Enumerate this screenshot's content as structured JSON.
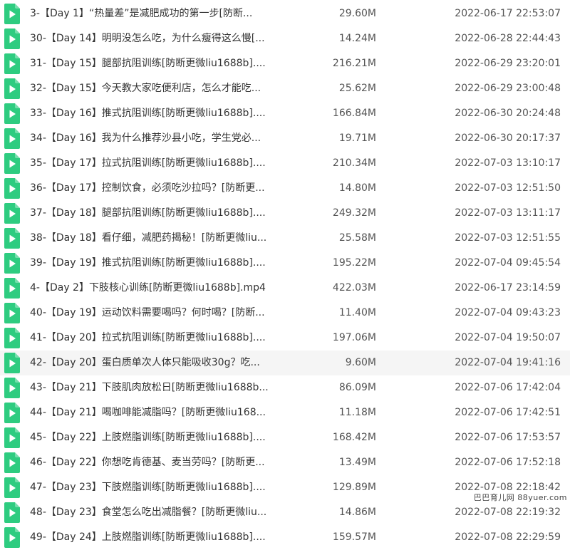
{
  "colors": {
    "icon_green": "#2ecc80",
    "icon_play": "#ffffff",
    "hover_row": "#f5f5f5"
  },
  "icon": "video-file-icon",
  "files": [
    {
      "name": "3-【Day 1】“热量差”是减肥成功的第一步[防断...",
      "size": "29.60M",
      "date": "2022-06-17 22:53:07"
    },
    {
      "name": "30-【Day 14】明明没怎么吃，为什么瘦得这么慢[...",
      "size": "14.24M",
      "date": "2022-06-28 22:44:43"
    },
    {
      "name": "31-【Day 15】腿部抗阻训练[防断更微liu1688b]....",
      "size": "216.21M",
      "date": "2022-06-29 23:20:01"
    },
    {
      "name": "32-【Day 15】今天教大家吃便利店，怎么才能吃...",
      "size": "25.62M",
      "date": "2022-06-29 23:00:48"
    },
    {
      "name": "33-【Day 16】推式抗阻训练[防断更微liu1688b]....",
      "size": "166.84M",
      "date": "2022-06-30 20:24:48"
    },
    {
      "name": "34-【Day 16】我为什么推荐沙县小吃，学生党必...",
      "size": "19.71M",
      "date": "2022-06-30 20:17:37"
    },
    {
      "name": "35-【Day 17】拉式抗阻训练[防断更微liu1688b]....",
      "size": "210.34M",
      "date": "2022-07-03 13:10:17"
    },
    {
      "name": "36-【Day 17】控制饮食，必须吃沙拉吗？[防断更...",
      "size": "14.80M",
      "date": "2022-07-03 12:51:50"
    },
    {
      "name": "37-【Day 18】腿部抗阻训练[防断更微liu1688b]....",
      "size": "249.32M",
      "date": "2022-07-03 13:11:17"
    },
    {
      "name": "38-【Day 18】看仔细，减肥药揭秘！[防断更微liu...",
      "size": "25.58M",
      "date": "2022-07-03 12:51:55"
    },
    {
      "name": "39-【Day 19】推式抗阻训练[防断更微liu1688b]....",
      "size": "195.22M",
      "date": "2022-07-04 09:45:54"
    },
    {
      "name": "4-【Day 2】下肢核心训练[防断更微liu1688b].mp4",
      "size": "422.03M",
      "date": "2022-06-17 23:14:59"
    },
    {
      "name": "40-【Day 19】运动饮料需要喝吗？何时喝？[防断...",
      "size": "11.40M",
      "date": "2022-07-04 09:43:23"
    },
    {
      "name": "41-【Day 20】拉式抗阻训练[防断更微liu1688b]....",
      "size": "197.06M",
      "date": "2022-07-04 19:50:07"
    },
    {
      "name": "42-【Day 20】蛋白质单次人体只能吸收30g？吃...",
      "size": "9.60M",
      "date": "2022-07-04 19:41:16",
      "hover": true
    },
    {
      "name": "43-【Day 21】下肢肌肉放松日[防断更微liu1688b...",
      "size": "86.09M",
      "date": "2022-07-06 17:42:04"
    },
    {
      "name": "44-【Day 21】喝咖啡能减脂吗？[防断更微liu168...",
      "size": "11.18M",
      "date": "2022-07-06 17:42:51"
    },
    {
      "name": "45-【Day 22】上肢燃脂训练[防断更微liu1688b]....",
      "size": "168.42M",
      "date": "2022-07-06 17:53:57"
    },
    {
      "name": "46-【Day 22】你想吃肯德基、麦当劳吗？[防断更...",
      "size": "13.49M",
      "date": "2022-07-06 17:52:18"
    },
    {
      "name": "47-【Day 23】下肢燃脂训练[防断更微liu1688b]....",
      "size": "129.89M",
      "date": "2022-07-08 22:18:42"
    },
    {
      "name": "48-【Day 23】食堂怎么吃出减脂餐？[防断更微liu...",
      "size": "14.86M",
      "date": "2022-07-08 22:19:32"
    },
    {
      "name": "49-【Day 24】上肢燃脂训练[防断更微liu1688b]....",
      "size": "159.57M",
      "date": "2022-07-08 22:29:59"
    }
  ],
  "watermark": "巴巴育儿网 88yuer.com"
}
